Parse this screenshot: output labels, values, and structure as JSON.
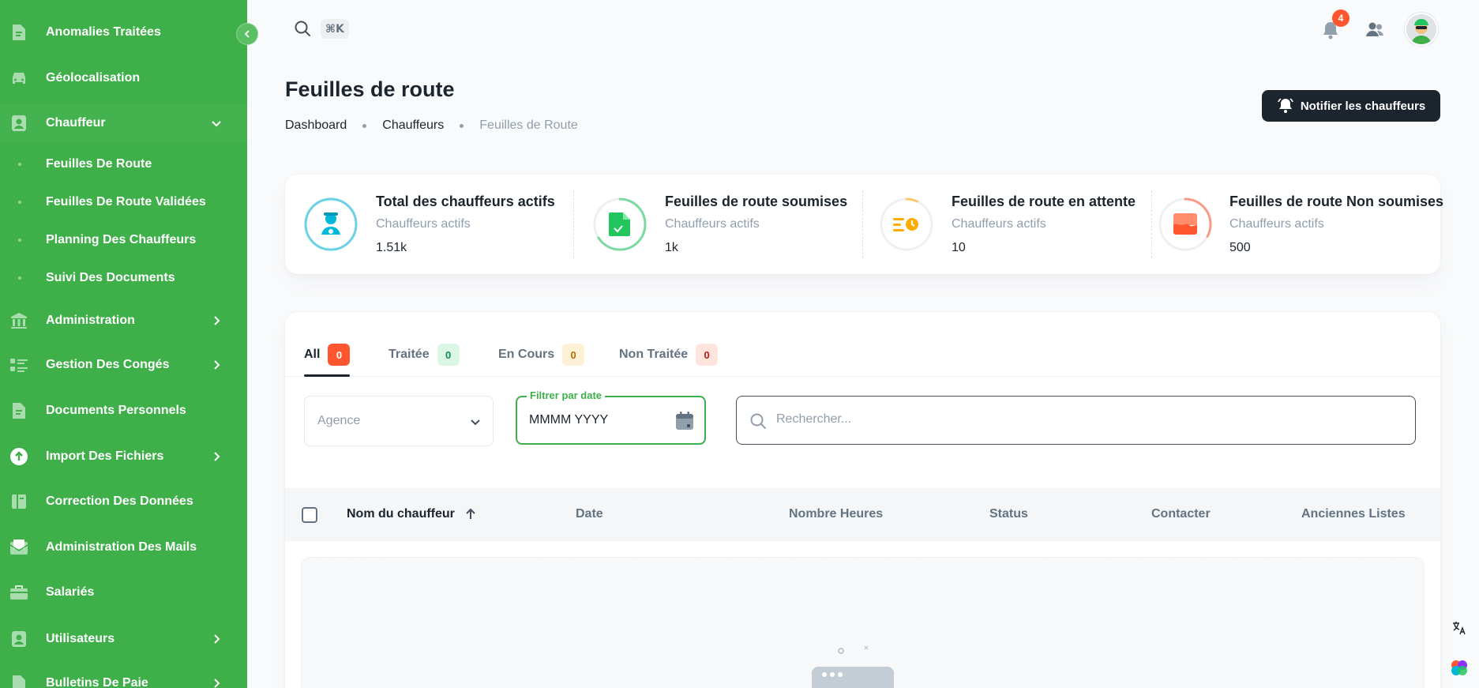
{
  "sidebar": {
    "items": [
      {
        "label": "Anomalies Traitées",
        "icon": "document-icon"
      },
      {
        "label": "Géolocalisation",
        "icon": "car-icon"
      },
      {
        "label": "Chauffeur",
        "icon": "user-icon",
        "expanded": true
      },
      {
        "label": "Administration",
        "icon": "bank-icon"
      },
      {
        "label": "Gestion Des Congés",
        "icon": "list-icon"
      },
      {
        "label": "Documents Personnels",
        "icon": "document-icon"
      },
      {
        "label": "Import Des Fichiers",
        "icon": "upload-icon"
      },
      {
        "label": "Correction Des Données",
        "icon": "folder-icon"
      },
      {
        "label": "Administration Des Mails",
        "icon": "mail-icon"
      },
      {
        "label": "Salariés",
        "icon": "briefcase-icon"
      },
      {
        "label": "Utilisateurs",
        "icon": "user-icon"
      },
      {
        "label": "Bulletins De Paie",
        "icon": "document-icon"
      }
    ],
    "sub_items": [
      {
        "label": "Feuilles De Route"
      },
      {
        "label": "Feuilles De Route Validées"
      },
      {
        "label": "Planning Des Chauffeurs"
      },
      {
        "label": "Suivi Des Documents"
      }
    ],
    "color": "#3eaf49"
  },
  "header": {
    "search_shortcut": "⌘K",
    "notification_count": "4"
  },
  "page": {
    "title": "Feuilles de route",
    "breadcrumb": [
      "Dashboard",
      "Chauffeurs",
      "Feuilles de Route"
    ],
    "notify_button": "Notifier les chauffeurs"
  },
  "stats": [
    {
      "title": "Total des chauffeurs actifs",
      "subtitle": "Chauffeurs actifs",
      "value": "1.51k",
      "color": "#00b8d9",
      "progress": 1.0
    },
    {
      "title": "Feuilles de route soumises",
      "subtitle": "Chauffeurs actifs",
      "value": "1k",
      "color": "#22c55e",
      "progress": 0.66
    },
    {
      "title": "Feuilles de route en attente",
      "subtitle": "Chauffeurs actifs",
      "value": "10",
      "color": "#ffab00",
      "progress": 0.07
    },
    {
      "title": "Feuilles de route Non soumises",
      "subtitle": "Chauffeurs actifs",
      "value": "500",
      "color": "#ff5630",
      "progress": 0.33
    }
  ],
  "tabs": [
    {
      "label": "All",
      "count": "0",
      "active": true
    },
    {
      "label": "Traitée",
      "count": "0"
    },
    {
      "label": "En Cours",
      "count": "0"
    },
    {
      "label": "Non Traitée",
      "count": "0"
    }
  ],
  "filters": {
    "agence_placeholder": "Agence",
    "date_label": "Filtrer par date",
    "date_placeholder": "MMMM YYYY",
    "search_placeholder": "Rechercher..."
  },
  "table": {
    "columns": [
      "Nom du chauffeur",
      "Date",
      "Nombre Heures",
      "Status",
      "Contacter",
      "Anciennes Listes"
    ]
  }
}
